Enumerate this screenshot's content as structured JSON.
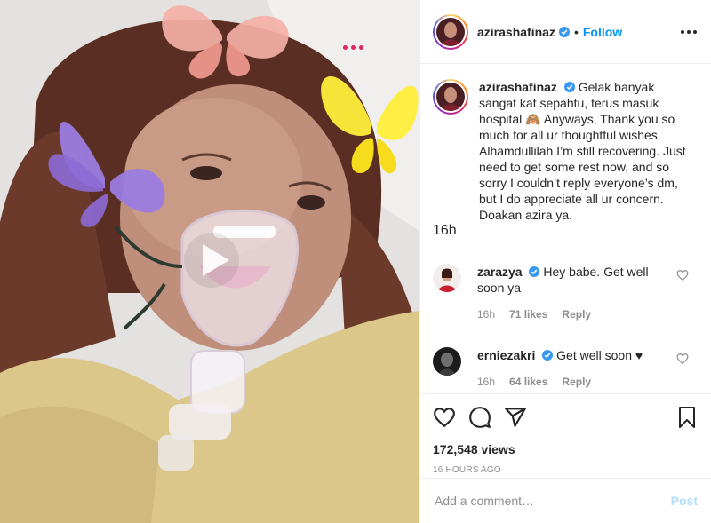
{
  "post": {
    "author": "azirashafinaz",
    "follow_label": "Follow",
    "dot": "•",
    "caption": "Gelak banyak sangat kat sepahtu, terus masuk hospital 🙈 Anyways, Thank you so much for all ur thoughtful wishes. Alhamdullilah I’m still recovering. Just need to get some rest now, and so sorry I couldn’t reply everyone’s dm, but I do appreciate all ur concern. Doakan azira ya.",
    "caption_time": "16h",
    "views": "172,548 views",
    "posted_ago": "16 HOURS AGO"
  },
  "comments": [
    {
      "user": "zarazya",
      "text": "Hey babe. Get well soon ya",
      "time": "16h",
      "likes": "71 likes",
      "reply": "Reply"
    },
    {
      "user": "erniezakri",
      "text": "Get well soon ♥",
      "time": "16h",
      "likes": "64 likes",
      "reply": "Reply"
    }
  ],
  "add_comment": {
    "placeholder": "Add a comment…",
    "post_label": "Post"
  },
  "colors": {
    "link_blue": "#0095f6",
    "muted_gray": "#8e8e8e",
    "text": "#262626",
    "post_disabled": "#b2dffc",
    "border": "#efefef"
  },
  "icons": [
    "verified-badge-icon",
    "more-options-icon",
    "like-heart-icon",
    "comment-bubble-icon",
    "share-direct-icon",
    "bookmark-icon",
    "comment-like-heart-icon",
    "play-icon"
  ]
}
